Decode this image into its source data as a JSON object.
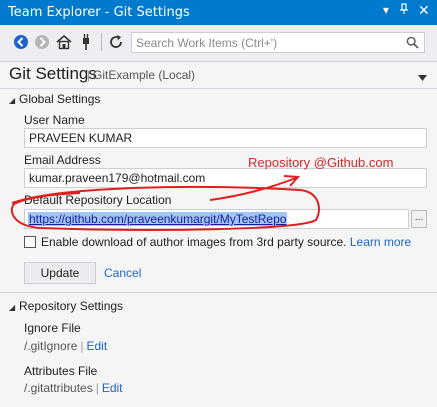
{
  "window": {
    "title": "Team Explorer - Git Settings"
  },
  "toolbar": {
    "search_placeholder": "Search Work Items (Ctrl+')"
  },
  "header": {
    "title": "Git Settings",
    "subtitle": "GitExample (Local)"
  },
  "global_settings": {
    "section_label": "Global Settings",
    "user_name_label": "User Name",
    "user_name_value": "PRAVEEN KUMAR",
    "email_label": "Email Address",
    "email_value": "kumar.praveen179@hotmail.com",
    "repo_location_label": "Default Repository Location",
    "repo_location_value": "https://github.com/praveenkumargit/MyTestRepo",
    "browse_label": "...",
    "checkbox_label": "Enable download of author images from 3rd party source.",
    "learn_more": "Learn more",
    "update_button": "Update",
    "cancel_link": "Cancel"
  },
  "repository_settings": {
    "section_label": "Repository Settings",
    "ignore_label": "Ignore File",
    "ignore_file": "/.gitIgnore",
    "ignore_edit": "Edit",
    "attributes_label": "Attributes File",
    "attributes_file": "/.gitattributes",
    "attributes_edit": "Edit"
  },
  "annotation": {
    "text": "Repository @Github.com",
    "color": "#d32a2a"
  },
  "colors": {
    "titlebar": "#007acc",
    "link": "#1e64c8",
    "selection": "#9ec6f0"
  }
}
